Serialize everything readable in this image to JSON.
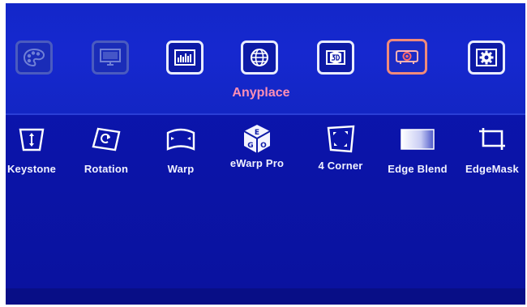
{
  "top_menu": {
    "title": "Anyplace",
    "items": [
      {
        "icon": "palette-icon",
        "state": "dim"
      },
      {
        "icon": "monitor-icon",
        "state": "dim"
      },
      {
        "icon": "audio-bars-icon",
        "state": "normal"
      },
      {
        "icon": "globe-icon",
        "state": "normal"
      },
      {
        "icon": "3d-icon",
        "state": "normal"
      },
      {
        "icon": "projector-icon",
        "state": "active"
      },
      {
        "icon": "gear-icon",
        "state": "normal"
      }
    ]
  },
  "sub_menu": {
    "items": [
      {
        "label": "Keystone",
        "icon": "keystone-icon"
      },
      {
        "label": "Rotation",
        "icon": "rotation-icon"
      },
      {
        "label": "Warp",
        "icon": "warp-icon"
      },
      {
        "label": "eWarp Pro",
        "icon": "ewarp-cube-icon"
      },
      {
        "label": "4 Corner",
        "icon": "four-corner-icon"
      },
      {
        "label": "Edge Blend",
        "icon": "edge-blend-icon"
      },
      {
        "label": "EdgeMask",
        "icon": "edge-mask-icon"
      }
    ]
  },
  "colors": {
    "background": "#0b15ad",
    "active_border": "#f08a7a",
    "title": "#ff8fb5",
    "label": "#f1f2ff"
  }
}
